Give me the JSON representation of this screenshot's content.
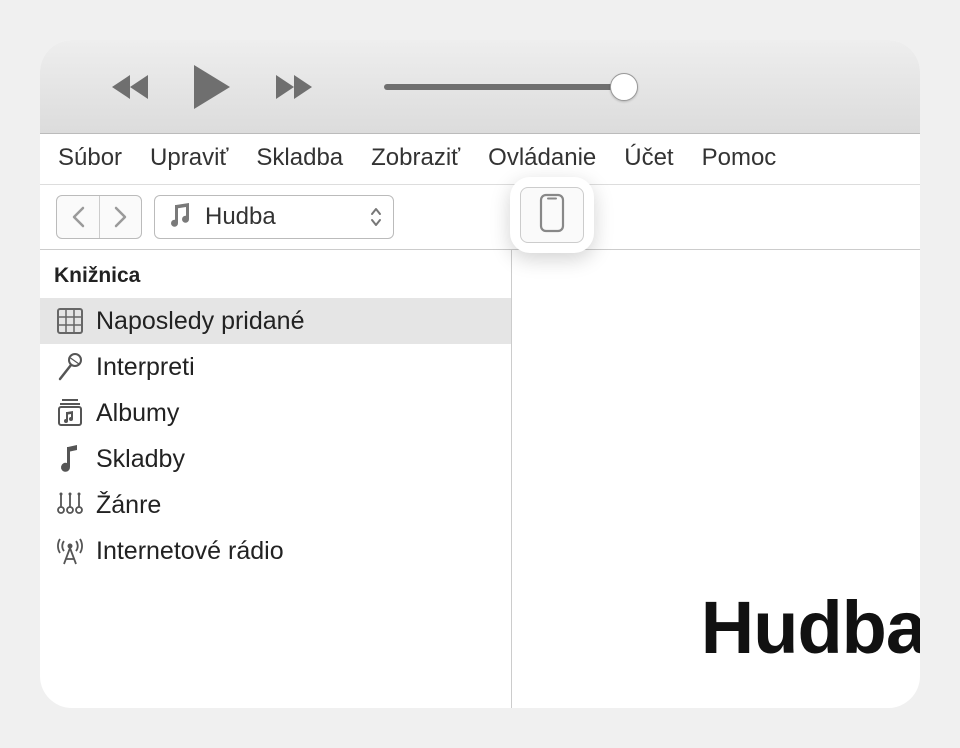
{
  "menu": {
    "items": [
      "Súbor",
      "Upraviť",
      "Skladba",
      "Zobraziť",
      "Ovládanie",
      "Účet",
      "Pomoc"
    ]
  },
  "toolbar": {
    "category": "Hudba"
  },
  "sidebar": {
    "header": "Knižnica",
    "items": [
      {
        "label": "Naposledy pridané",
        "icon": "grid-icon",
        "selected": true
      },
      {
        "label": "Interpreti",
        "icon": "microphone-icon",
        "selected": false
      },
      {
        "label": "Albumy",
        "icon": "album-icon",
        "selected": false
      },
      {
        "label": "Skladby",
        "icon": "note-icon",
        "selected": false
      },
      {
        "label": "Žánre",
        "icon": "guitar-icon",
        "selected": false
      },
      {
        "label": "Internetové rádio",
        "icon": "radio-tower-icon",
        "selected": false
      }
    ]
  },
  "main": {
    "title": "Hudba"
  }
}
